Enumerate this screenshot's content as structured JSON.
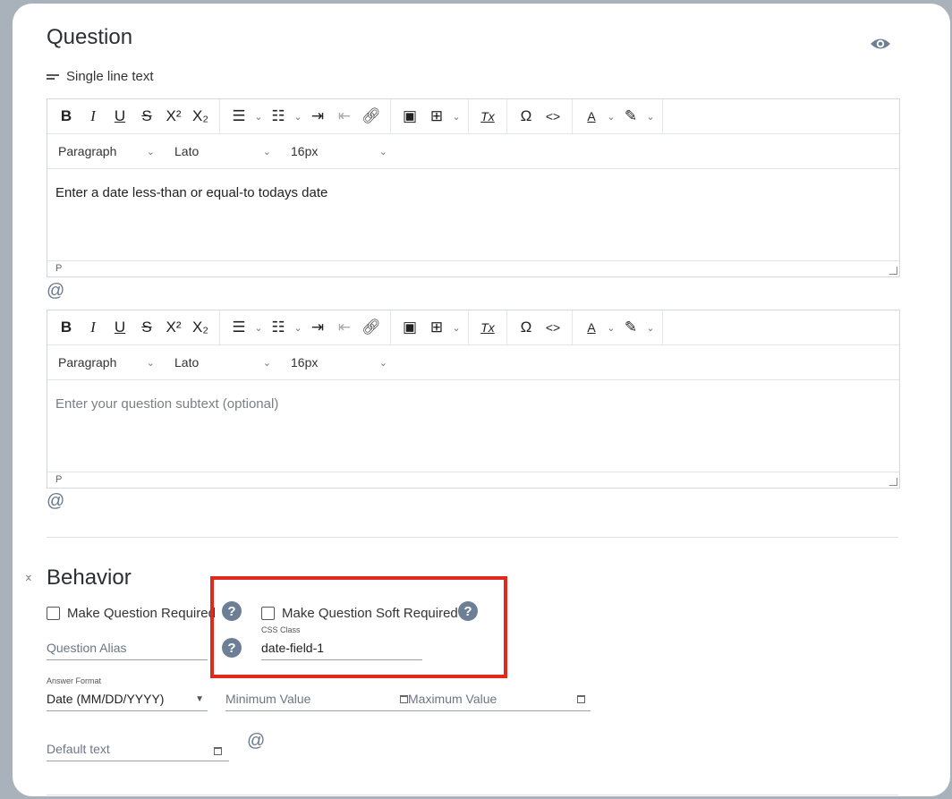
{
  "question": {
    "title": "Question",
    "type_label": "Single line text"
  },
  "toolbar": {
    "bold": "B",
    "italic": "I",
    "underline": "U",
    "strike": "S",
    "superscript": "X²",
    "subscript": "X₂",
    "clear_format": "Tx",
    "special_char": "Ω",
    "source": "<>",
    "text_color": "A"
  },
  "editor1": {
    "block_format": "Paragraph",
    "font_family": "Lato",
    "font_size": "16px",
    "content": "Enter a date less-than or equal-to todays date",
    "status_path": "P"
  },
  "editor2": {
    "block_format": "Paragraph",
    "font_family": "Lato",
    "font_size": "16px",
    "placeholder": "Enter your question subtext (optional)",
    "status_path": "P"
  },
  "mention_symbol": "@",
  "behavior": {
    "title": "Behavior",
    "required_label": "Make Question Required",
    "soft_required_label": "Make Question Soft Required",
    "alias_placeholder": "Question Alias",
    "css_class_label": "CSS Class",
    "css_class_value": "date-field-1",
    "answer_format_label": "Answer Format",
    "answer_format_value": "Date (MM/DD/YYYY)",
    "min_value_placeholder": "Minimum Value",
    "max_value_placeholder": "Maximum Value",
    "default_text_placeholder": "Default text",
    "help_glyph": "?"
  },
  "colors": {
    "highlight": "#e02a1b",
    "help_icon": "#6d7f95",
    "mention": "#6a7a8c"
  }
}
